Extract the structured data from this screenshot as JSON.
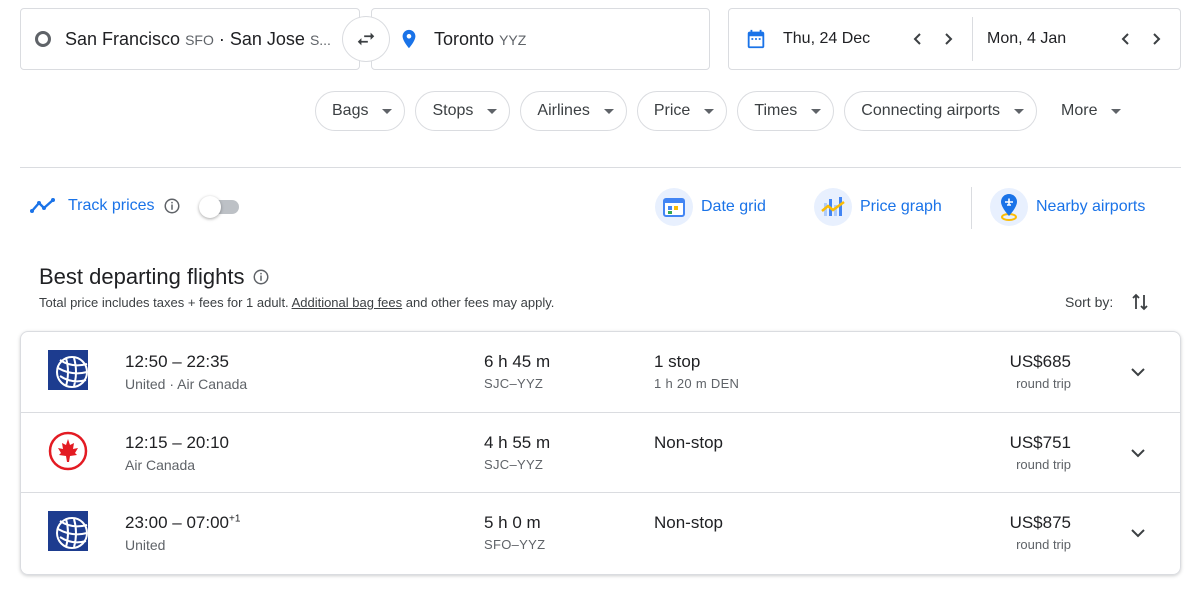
{
  "search": {
    "origin": {
      "text": "San Francisco",
      "code1": "SFO",
      "sep": " · ",
      "text2": "San Jose",
      "code2": "S..."
    },
    "destination": {
      "text": "Toronto",
      "code": "YYZ"
    },
    "depart_date": "Thu, 24 Dec",
    "return_date": "Mon, 4 Jan"
  },
  "filters": [
    "Bags",
    "Stops",
    "Airlines",
    "Price",
    "Times",
    "Connecting airports",
    "More"
  ],
  "tools": {
    "track_prices": "Track prices",
    "date_grid": "Date grid",
    "price_graph": "Price graph",
    "nearby_airports": "Nearby airports"
  },
  "heading": {
    "title": "Best departing flights",
    "note_prefix": "Total price includes taxes + fees for 1 adult. ",
    "note_link": "Additional bag fees",
    "note_suffix": " and other fees may apply.",
    "sort_label": "Sort by:"
  },
  "colors": {
    "accent": "#1a73e8",
    "united_navy": "#1d3c8f",
    "air_canada_red": "#e31b23"
  },
  "flights": [
    {
      "logo": "united-logo",
      "times": "12:50 – 22:35",
      "day_offset": "",
      "airline": "United  ·  Air Canada",
      "duration": "6 h 45 m",
      "route": "SJC–YYZ",
      "stops": "1 stop",
      "layover": "1 h 20 m DEN",
      "price": "US$685",
      "trip": "round trip"
    },
    {
      "logo": "air-canada-logo",
      "times": "12:15 – 20:10",
      "day_offset": "",
      "airline": "Air Canada",
      "duration": "4 h 55 m",
      "route": "SJC–YYZ",
      "stops": "Non-stop",
      "layover": "",
      "price": "US$751",
      "trip": "round trip"
    },
    {
      "logo": "united-logo",
      "times": "23:00 – 07:00",
      "day_offset": "+1",
      "airline": "United",
      "duration": "5 h 0 m",
      "route": "SFO–YYZ",
      "stops": "Non-stop",
      "layover": "",
      "price": "US$875",
      "trip": "round trip"
    }
  ]
}
